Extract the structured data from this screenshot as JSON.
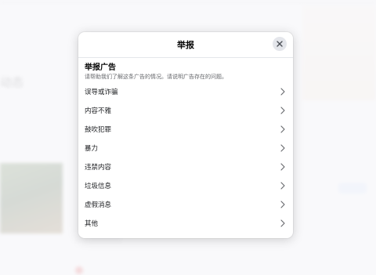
{
  "background": {
    "heading": "动态",
    "tab_a": "",
    "tab_b": "",
    "ad_text": "",
    "footer_text": "",
    "footer_meta": ""
  },
  "dialog": {
    "title": "举报",
    "section_title": "举报广告",
    "section_description": "请帮助我们了解这条广告的情况。请说明广告存在的问题。",
    "options": [
      "误导或诈骗",
      "内容不雅",
      "鼓吹犯罪",
      "暴力",
      "违禁内容",
      "垃圾信息",
      "虚假消息",
      "其他"
    ]
  },
  "icons": {
    "close": "close-icon",
    "chevron": "chevron-right-icon"
  },
  "colors": {
    "text_primary": "#050505",
    "text_secondary": "#65676b",
    "close_bg": "#e4e6eb"
  }
}
